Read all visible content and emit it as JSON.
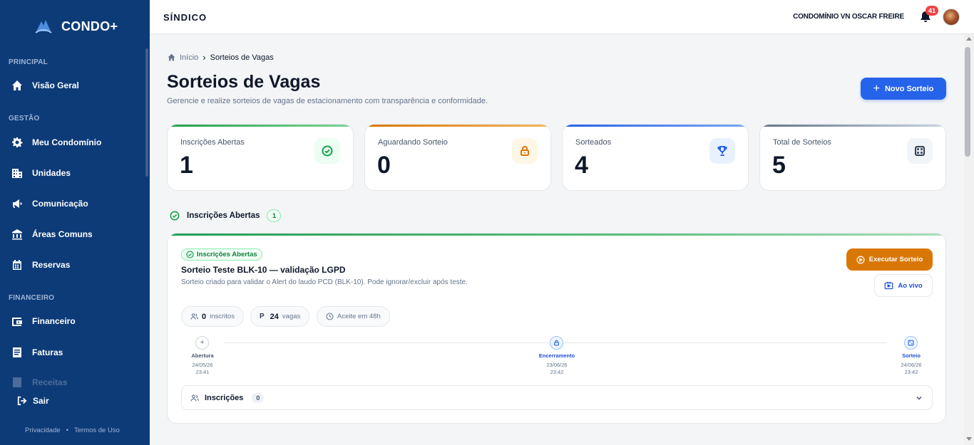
{
  "app": {
    "name": "CONDO+"
  },
  "sidebar": {
    "sections": {
      "principal": "PRINCIPAL",
      "gestao": "GESTÃO",
      "financeiro": "FINANCEIRO"
    },
    "items": [
      {
        "label": "Visão Geral",
        "icon": "home-icon"
      },
      {
        "label": "Meu Condomínio",
        "icon": "gear-icon"
      },
      {
        "label": "Unidades",
        "icon": "building-icon"
      },
      {
        "label": "Comunicação",
        "icon": "megaphone-icon"
      },
      {
        "label": "Áreas Comuns",
        "icon": "bank-icon"
      },
      {
        "label": "Reservas",
        "icon": "calendar-icon"
      },
      {
        "label": "Financeiro",
        "icon": "wallet-icon"
      },
      {
        "label": "Faturas",
        "icon": "invoice-icon"
      },
      {
        "label": "Receitas",
        "icon": "receipt-icon"
      }
    ],
    "logout": "Sair",
    "footer": {
      "privacy": "Privacidade",
      "separator": "•",
      "terms": "Termos de Uso"
    }
  },
  "topbar": {
    "title": "SÍNDICO",
    "condo": "CONDOMÍNIO VN OSCAR FREIRE",
    "notifications": "41"
  },
  "breadcrumb": {
    "home": "Início",
    "separator": "›",
    "current": "Sorteios de Vagas"
  },
  "page": {
    "title": "Sorteios de Vagas",
    "subtitle": "Gerencie e realize sorteios de vagas de estacionamento com transparência e conformidade.",
    "new_button": "Novo Sorteio"
  },
  "stats": [
    {
      "label": "Inscrições Abertas",
      "value": "1",
      "color": "#22a050"
    },
    {
      "label": "Aguardando Sorteio",
      "value": "0",
      "color": "#d97706"
    },
    {
      "label": "Sorteados",
      "value": "4",
      "color": "#2563eb"
    },
    {
      "label": "Total de Sorteios",
      "value": "5",
      "color": "#94a3b8"
    }
  ],
  "section": {
    "title": "Inscrições Abertas",
    "count": "1"
  },
  "card": {
    "status": "Inscrições Abertas",
    "title": "Sorteio Teste BLK-10 — validação LGPD",
    "description": "Sorteio criado para validar o Alert do laudo PCD (BLK-10). Pode ignorar/excluir após teste.",
    "execute_button": "Executar Sorteio",
    "live_button": "Ao vivo",
    "chips": {
      "inscritos_value": "0",
      "inscritos_label": "inscritos",
      "vagas_value": "24",
      "vagas_label": "vagas",
      "vagas_prefix": "P",
      "aceite": "Aceite em 48h"
    },
    "timeline": [
      {
        "label": "Abertura",
        "date": "24/05/26",
        "time": "23:41"
      },
      {
        "label": "Encerramento",
        "date": "23/06/26",
        "time": "23:42"
      },
      {
        "label": "Sorteio",
        "date": "24/06/26",
        "time": "23:42"
      }
    ],
    "accordion": {
      "label": "Inscrições",
      "count": "0"
    }
  }
}
